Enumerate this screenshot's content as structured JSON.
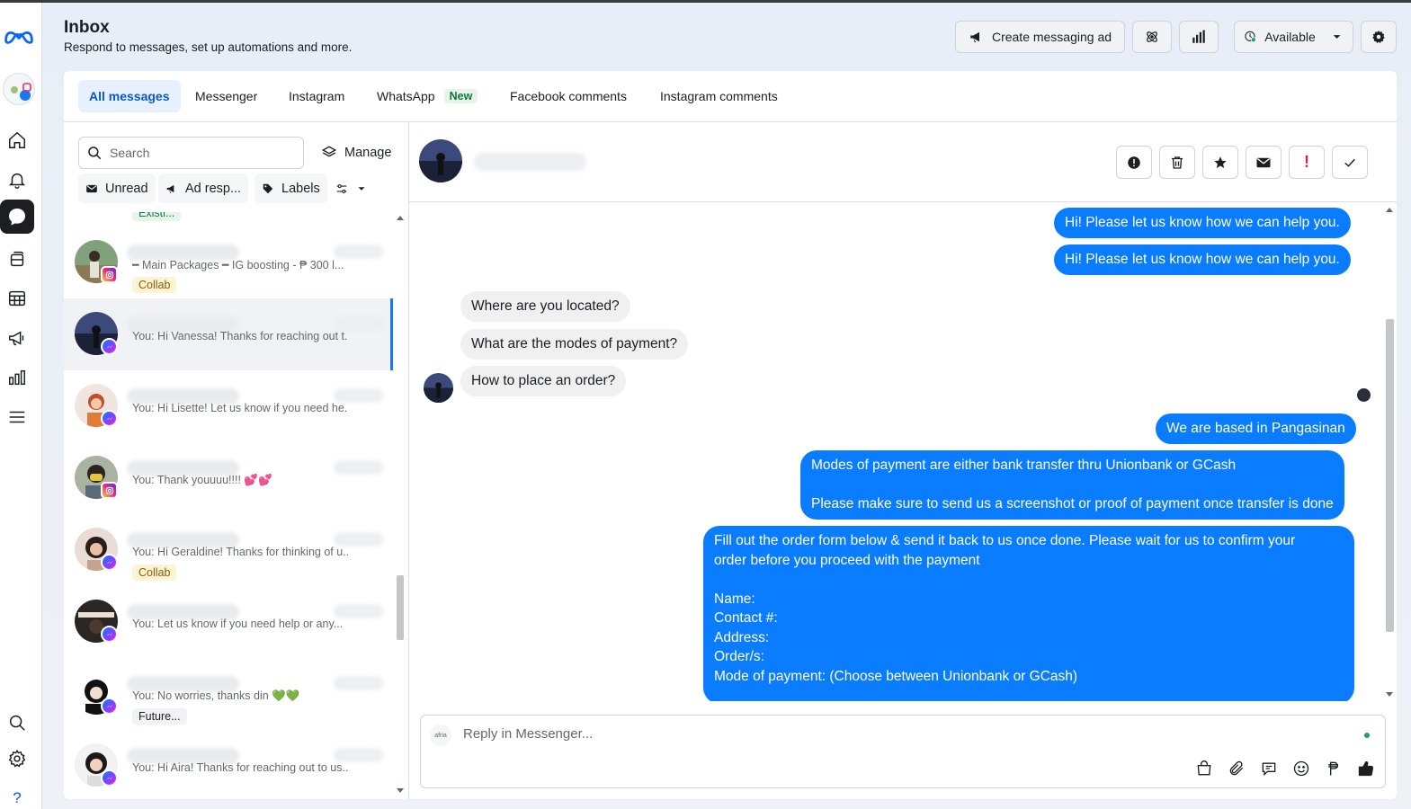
{
  "header": {
    "title": "Inbox",
    "subtitle": "Respond to messages, set up automations and more.",
    "create_ad_label": "Create messaging ad",
    "status_label": "Available"
  },
  "rail": {
    "items": [
      "home-icon",
      "bell-icon",
      "chat-icon",
      "posts-icon",
      "table-icon",
      "megaphone-icon",
      "insights-icon",
      "menu-icon",
      "search-icon",
      "gear-icon",
      "help-icon"
    ],
    "help_glyph": "?"
  },
  "tabs": [
    {
      "label": "All messages",
      "active": true
    },
    {
      "label": "Messenger"
    },
    {
      "label": "Instagram"
    },
    {
      "label": "WhatsApp",
      "badge": "New"
    },
    {
      "label": "Facebook comments"
    },
    {
      "label": "Instagram comments"
    }
  ],
  "list": {
    "search_placeholder": "Search",
    "manage_label": "Manage",
    "filters": {
      "unread": "Unread",
      "ad": "Ad resp...",
      "labels": "Labels"
    },
    "partial_tag": "Existi...",
    "conversations": [
      {
        "preview": "━ Main Packages ━  IG boosting - ₱ 300 l...",
        "platform": "instagram",
        "tag": "Collab",
        "tag_type": "collab"
      },
      {
        "preview": "You: Hi Vanessa! Thanks for reaching out t...",
        "platform": "messenger",
        "selected": true
      },
      {
        "preview": "You: Hi Lisette! Let us know if you need he...",
        "platform": "messenger"
      },
      {
        "preview": "You: Thank youuuu!!!! 💕💕",
        "platform": "instagram"
      },
      {
        "preview": "You: Hi Geraldine! Thanks for thinking of u...",
        "platform": "messenger",
        "tag": "Collab",
        "tag_type": "collab"
      },
      {
        "preview": "You: Let us know if you need help or any...",
        "platform": "messenger"
      },
      {
        "preview": "You: No worries, thanks din 💚💚",
        "platform": "messenger",
        "tag": "Future...",
        "tag_type": "future"
      },
      {
        "preview": "You: Hi Aira! Thanks for reaching out to us....",
        "platform": "messenger"
      }
    ]
  },
  "chat": {
    "messages": [
      {
        "dir": "out",
        "text": "Hi! Please let us know how we can help you."
      },
      {
        "dir": "out",
        "text": "Hi! Please let us know how we can help you."
      },
      {
        "dir": "in",
        "text": "Where are you located?"
      },
      {
        "dir": "in",
        "text": "What are the modes of payment?"
      },
      {
        "dir": "in",
        "text": "How to place an order?"
      },
      {
        "dir": "out",
        "text": "We are based in Pangasinan"
      },
      {
        "dir": "out",
        "text": "Modes of payment are either bank transfer thru Unionbank or GCash\n\nPlease make sure to send us a screenshot or proof of payment once transfer is done"
      },
      {
        "dir": "out",
        "text": "Fill out the order form below & send it back to us once done. Please wait for us to confirm your\norder before you proceed with the payment\n\nName:\nContact #:\nAddress:\nOrder/s:\nMode of payment: (Choose between Unionbank or GCash)"
      }
    ],
    "actions": [
      "alert-circle-icon",
      "trash-icon",
      "star-icon",
      "envelope-icon",
      "exclamation-icon",
      "check-icon"
    ],
    "spam_glyph": "!",
    "composer_placeholder": "Reply in Messenger...",
    "composer_logo": "afria"
  },
  "colors": {
    "accent": "#0a7cff",
    "brand": "#1877f2",
    "rail_active": "#1c1e21"
  }
}
